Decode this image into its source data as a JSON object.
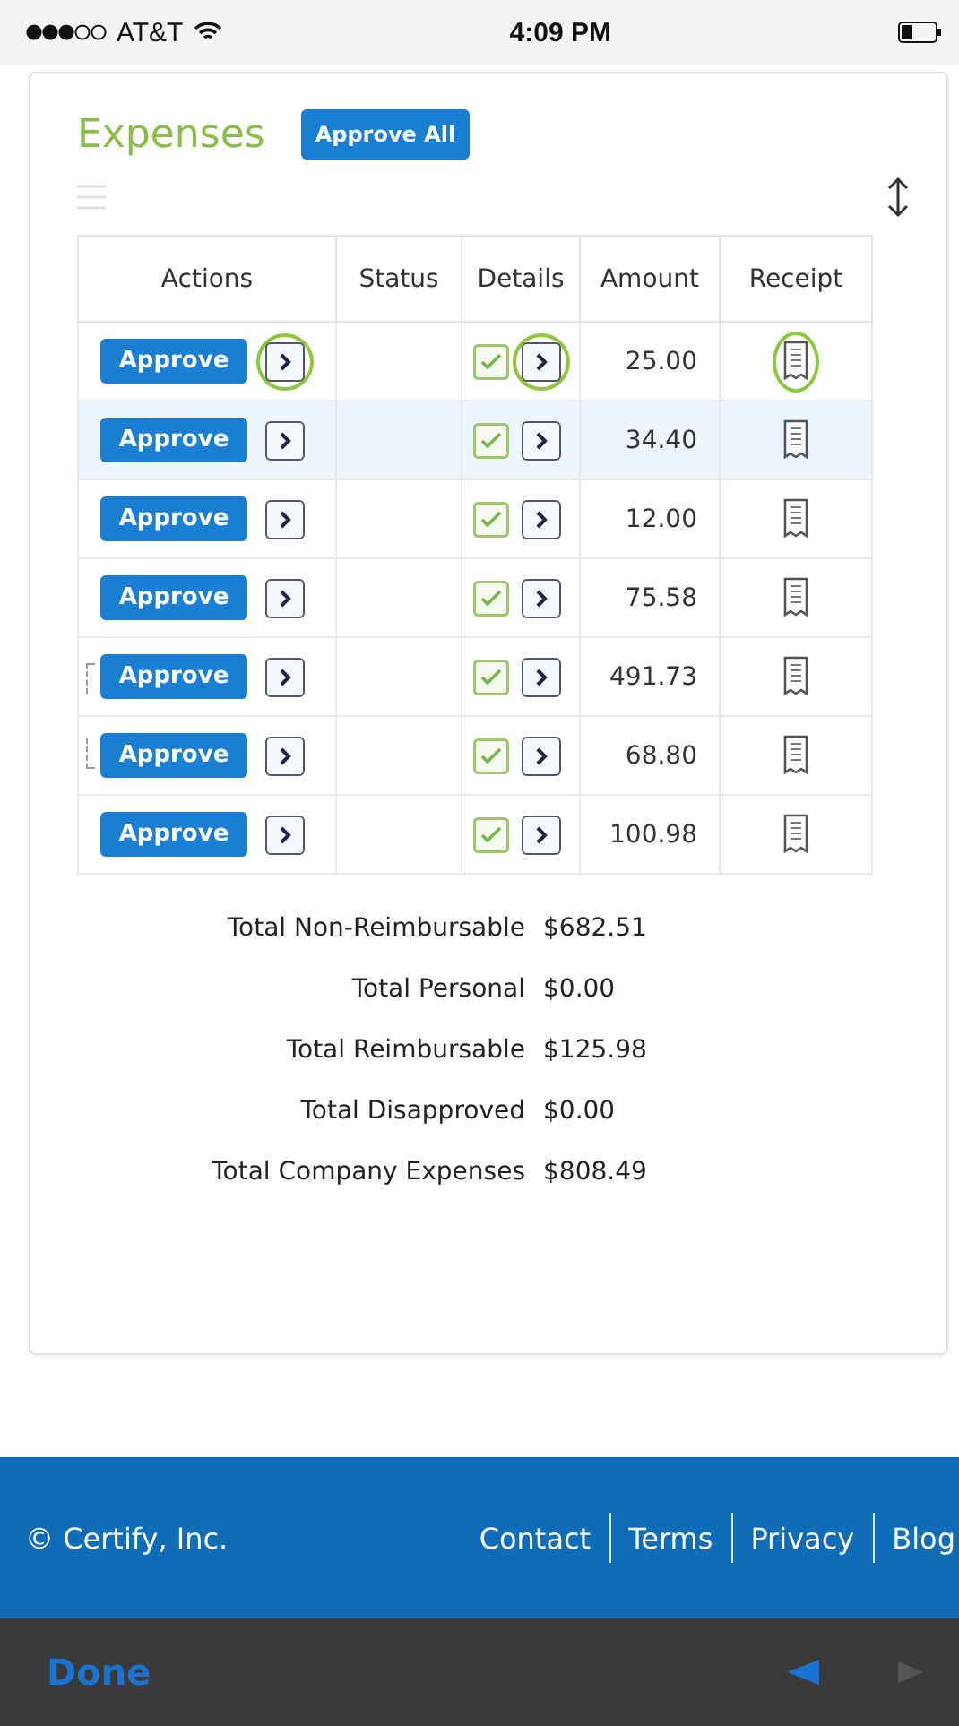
{
  "status_bar": {
    "carrier": "AT&T",
    "time": "4:09 PM"
  },
  "title": "Expenses",
  "approve_all": "Approve All",
  "table": {
    "columns": [
      "Actions",
      "Status",
      "Details",
      "Amount",
      "Receipt"
    ],
    "rows": [
      {
        "action": "Approve",
        "checked": true,
        "amount": "25.00",
        "selected": false,
        "highlighted": true,
        "grouped": false
      },
      {
        "action": "Approve",
        "checked": true,
        "amount": "34.40",
        "selected": true,
        "highlighted": false,
        "grouped": false
      },
      {
        "action": "Approve",
        "checked": true,
        "amount": "12.00",
        "selected": false,
        "highlighted": false,
        "grouped": false
      },
      {
        "action": "Approve",
        "checked": true,
        "amount": "75.58",
        "selected": false,
        "highlighted": false,
        "grouped": false
      },
      {
        "action": "Approve",
        "checked": true,
        "amount": "491.73",
        "selected": false,
        "highlighted": false,
        "grouped": true
      },
      {
        "action": "Approve",
        "checked": true,
        "amount": "68.80",
        "selected": false,
        "highlighted": false,
        "grouped": true
      },
      {
        "action": "Approve",
        "checked": true,
        "amount": "100.98",
        "selected": false,
        "highlighted": false,
        "grouped": false
      }
    ]
  },
  "totals": [
    {
      "label": "Total Non-Reimbursable",
      "value": "$682.51"
    },
    {
      "label": "Total Personal",
      "value": "$0.00"
    },
    {
      "label": "Total Reimbursable",
      "value": "$125.98"
    },
    {
      "label": "Total Disapproved",
      "value": "$0.00"
    },
    {
      "label": "Total Company Expenses",
      "value": "$808.49"
    }
  ],
  "footer": {
    "copyright": "© Certify, Inc.",
    "links": [
      "Contact",
      "Terms",
      "Privacy",
      "Blog"
    ]
  },
  "toolbar": {
    "done": "Done"
  }
}
